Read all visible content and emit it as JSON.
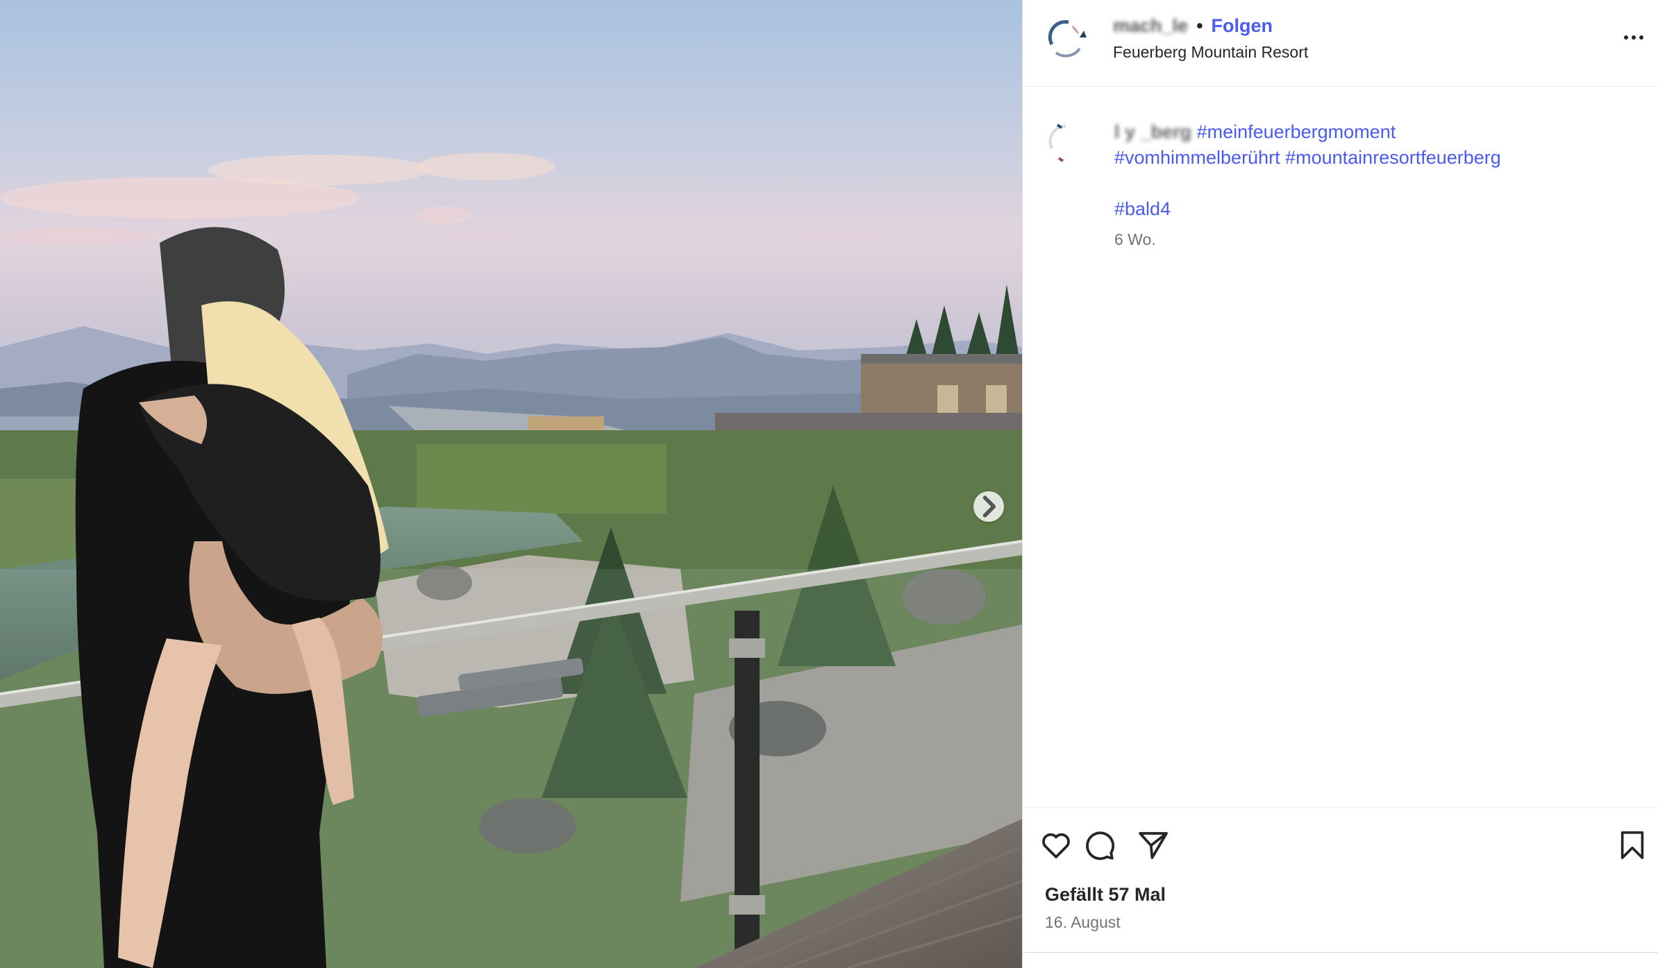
{
  "post": {
    "image_alt": "Man holding a blond girl on a balcony overlooking a mountain resort garden at dusk",
    "next_icon": "chevron-right-icon"
  },
  "header": {
    "username": "mach_le",
    "separator": "•",
    "follow_label": "Folgen",
    "location": "Feuerberg Mountain Resort",
    "more_icon": "more-horizontal-icon"
  },
  "caption": {
    "username": "l y _berg",
    "hashtags_line1": [
      "#meinfeuerbergmoment"
    ],
    "hashtags_line2": [
      "#vomhimmelberührt",
      "#mountainresortfeuerberg"
    ],
    "hashtag_extra": "#bald4",
    "age": "6 Wo."
  },
  "actions": {
    "like_icon": "heart-icon",
    "comment_icon": "comment-icon",
    "share_icon": "send-icon",
    "save_icon": "bookmark-icon"
  },
  "likes": "Gefällt 57 Mal",
  "date": "16. August",
  "colors": {
    "link": "#4a5bf0",
    "text": "#262626",
    "muted": "#737373"
  }
}
